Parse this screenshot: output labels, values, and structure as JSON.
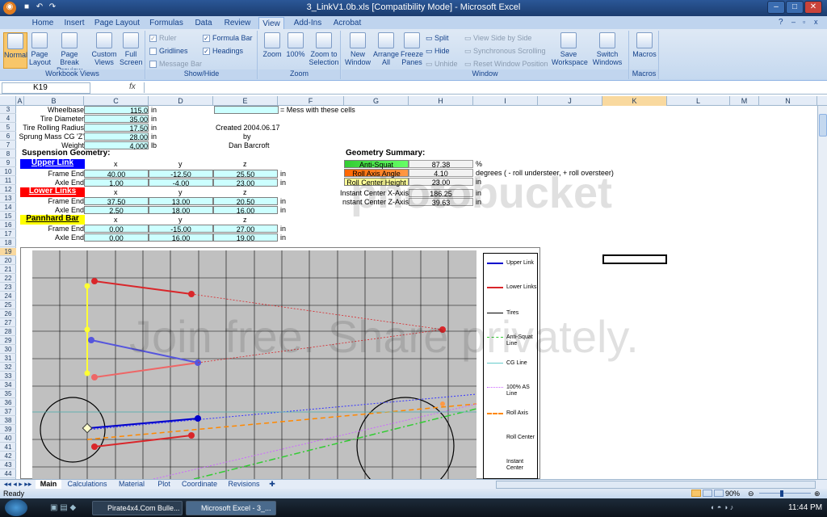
{
  "window": {
    "title": "3_LinkV1.0b.xls  [Compatibility Mode] - Microsoft Excel"
  },
  "ribbon_tabs": [
    "Home",
    "Insert",
    "Page Layout",
    "Formulas",
    "Data",
    "Review",
    "View",
    "Add-Ins",
    "Acrobat"
  ],
  "active_tab": "View",
  "ribbon": {
    "workbook_views": {
      "label": "Workbook Views",
      "normal": "Normal",
      "page_layout": "Page Layout",
      "page_break": "Page Break Preview",
      "custom": "Custom Views",
      "full": "Full Screen"
    },
    "show_hide": {
      "label": "Show/Hide",
      "ruler": "Ruler",
      "gridlines": "Gridlines",
      "message_bar": "Message Bar",
      "formula_bar": "Formula Bar",
      "headings": "Headings"
    },
    "zoom": {
      "label": "Zoom",
      "zoom": "Zoom",
      "p100": "100%",
      "zoom_sel": "Zoom to Selection"
    },
    "window": {
      "label": "Window",
      "new_window": "New Window",
      "arrange_all": "Arrange All",
      "freeze": "Freeze Panes",
      "split": "Split",
      "hide": "Hide",
      "unhide": "Unhide",
      "side": "View Side by Side",
      "sync": "Synchronous Scrolling",
      "reset": "Reset Window Position",
      "save_ws": "Save Workspace",
      "switch": "Switch Windows"
    },
    "macros": {
      "label": "Macros",
      "macros": "Macros"
    }
  },
  "name_box": "K19",
  "fx": "fx",
  "columns": [
    "A",
    "B",
    "C",
    "D",
    "E",
    "F",
    "G",
    "H",
    "I",
    "J",
    "K",
    "L",
    "M",
    "N"
  ],
  "rows": [
    "3",
    "4",
    "5",
    "6",
    "7",
    "8",
    "9",
    "10",
    "11",
    "12",
    "13",
    "14",
    "15",
    "16",
    "17",
    "18",
    "19",
    "20",
    "21",
    "22",
    "23",
    "24",
    "25",
    "26",
    "27",
    "28",
    "29",
    "30",
    "31",
    "32",
    "33",
    "34",
    "35",
    "36",
    "37",
    "38",
    "39",
    "40",
    "41",
    "42",
    "43",
    "44"
  ],
  "inputs": {
    "wheelbase": {
      "label": "Wheelbase",
      "value": "115.0",
      "unit": "in"
    },
    "tire_diameter": {
      "label": "Tire Diameter",
      "value": "35.00",
      "unit": "in"
    },
    "tire_rolling_radius": {
      "label": "Tire Rolling Radius",
      "value": "17.50",
      "unit": "in"
    },
    "sprung_mass_cg": {
      "label": "Sprung Mass CG 'Z'",
      "value": "28.00",
      "unit": "in"
    },
    "weight": {
      "label": "Weight",
      "value": "4,000",
      "unit": "lb"
    },
    "legend_note": "= Mess with these cells",
    "created": "Created 2004.06.17",
    "by": "by",
    "author": "Dan Barcroft"
  },
  "suspension": {
    "title": "Suspension Geometry:",
    "headers": [
      "x",
      "y",
      "z"
    ],
    "upper_link": {
      "title": "Upper Link",
      "frame": {
        "label": "Frame End",
        "x": "40.00",
        "y": "-12.50",
        "z": "25.50"
      },
      "axle": {
        "label": "Axle End",
        "x": "1.00",
        "y": "-4.00",
        "z": "23.00"
      }
    },
    "lower_links": {
      "title": "Lower Links",
      "frame": {
        "label": "Frame End",
        "x": "37.50",
        "y": "13.00",
        "z": "20.50"
      },
      "axle": {
        "label": "Axle End",
        "x": "2.50",
        "y": "18.00",
        "z": "16.00"
      }
    },
    "pannhard": {
      "title": "Pannhard Bar",
      "frame": {
        "label": "Frame End",
        "x": "0.00",
        "y": "-15.00",
        "z": "27.00"
      },
      "axle": {
        "label": "Axle End",
        "x": "0.00",
        "y": "16.00",
        "z": "19.00"
      }
    },
    "unit": "in"
  },
  "summary": {
    "title": "Geometry Summary:",
    "rows": [
      {
        "label": "Anti-Squat",
        "value": "87.38",
        "unit": "%"
      },
      {
        "label": "Roll Axis Angle",
        "value": "4.10",
        "unit": "degrees ( - roll understeer, + roll oversteer)"
      },
      {
        "label": "Roll Center Height",
        "value": "23.00",
        "unit": "in"
      },
      {
        "label": "Instant Center X-Axis",
        "value": "186.25",
        "unit": "in"
      },
      {
        "label": "nstant Center Z-Axis",
        "value": "39.63",
        "unit": "in"
      }
    ]
  },
  "legend": [
    "Upper Link",
    "Lower Links",
    "Tires",
    "Anti-Squat Line",
    "CG Line",
    "100% AS Line",
    "Roll Axis",
    "Roll Center",
    "Instant Center"
  ],
  "colors": {
    "upper": "#3333cc",
    "lower": "#d9262a",
    "pannhard": "#ffff33",
    "antisquat": "#33cc33",
    "rollaxis": "#ff8800",
    "as100": "#cc66ff",
    "cg": "#66cccc",
    "title_blue": "#0000ff",
    "title_red": "#ff0000",
    "title_yellow": "#ffff00"
  },
  "sheet_tabs": [
    "Main",
    "Calculations",
    "Material",
    "Plot",
    "Coordinate",
    "Revisions"
  ],
  "active_sheet": "Main",
  "status": {
    "ready": "Ready",
    "zoom": "90%"
  },
  "taskbar": {
    "items": [
      "Pirate4x4.Com Bulle...",
      "Microsoft Excel - 3_..."
    ],
    "clock": "11:44 PM"
  },
  "watermark": {
    "logo": "photobucket",
    "tagline": "Join free. Share privately."
  }
}
